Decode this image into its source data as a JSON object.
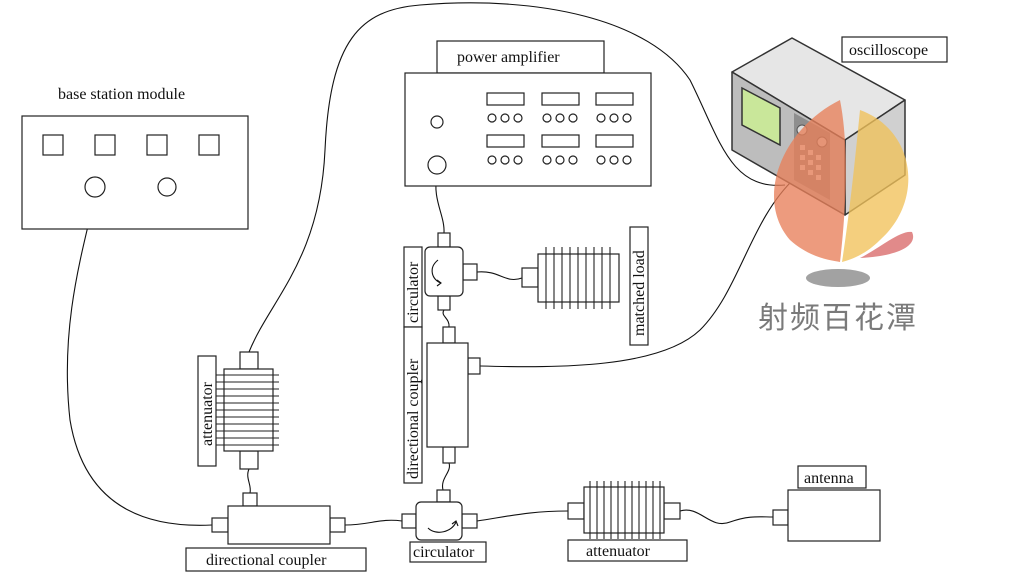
{
  "labels": {
    "base_station": "base station module",
    "power_amplifier": "power amplifier",
    "oscilloscope": "oscilloscope",
    "circulator_top": "circulator",
    "matched_load": "matched load",
    "directional_coupler_vertical": "directional coupler",
    "attenuator_vertical": "attenuator",
    "directional_coupler_bottom": "directional coupler",
    "circulator_bottom": "circulator",
    "attenuator_bottom": "attenuator",
    "antenna": "antenna"
  },
  "watermark": {
    "text": "射频百花潭",
    "colors": [
      "#e8805a",
      "#f1c25a",
      "#d96a6a",
      "#888888"
    ]
  }
}
